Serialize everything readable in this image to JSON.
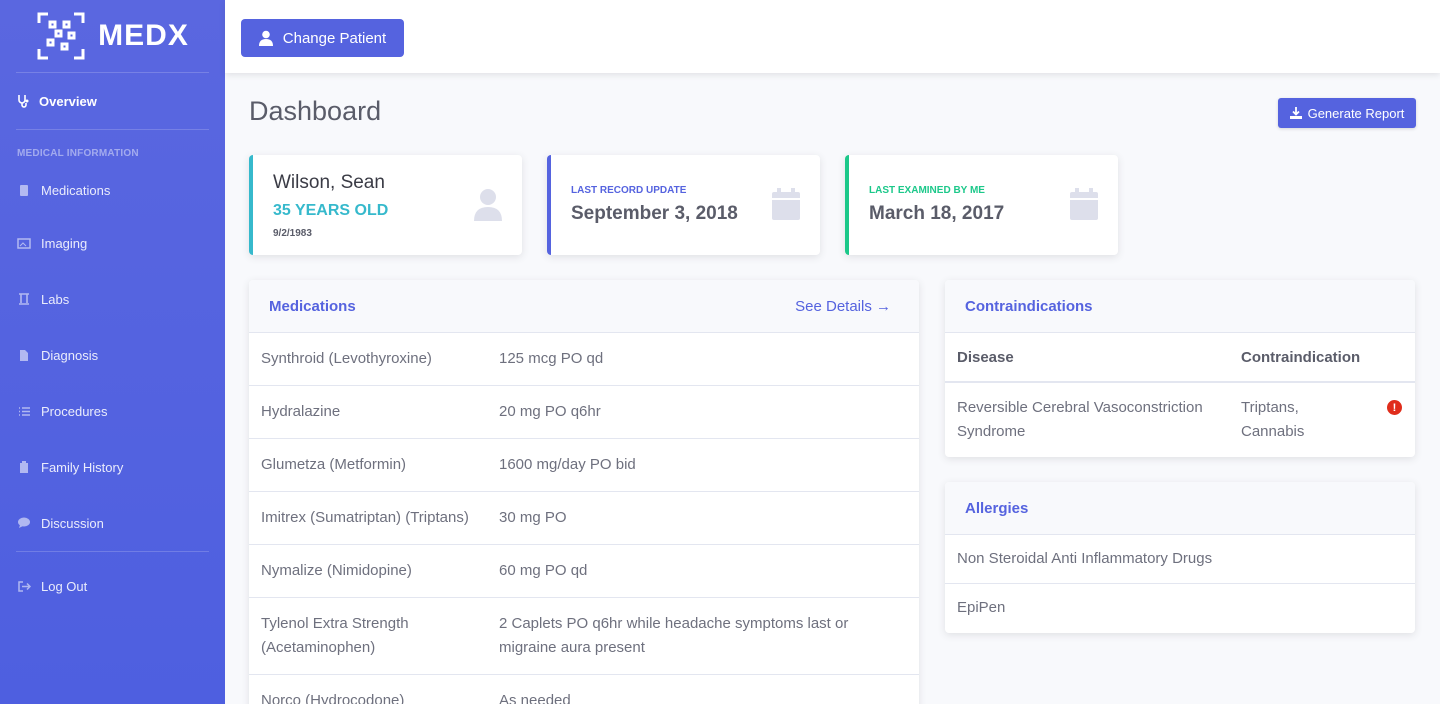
{
  "brand": {
    "name": "MEDX"
  },
  "sidebar": {
    "overview": "Overview",
    "heading": "Medical Information",
    "items": [
      {
        "label": "Medications",
        "icon": "pill-icon"
      },
      {
        "label": "Imaging",
        "icon": "image-icon"
      },
      {
        "label": "Labs",
        "icon": "flask-icon"
      },
      {
        "label": "Diagnosis",
        "icon": "file-icon"
      },
      {
        "label": "Procedures",
        "icon": "list-icon"
      },
      {
        "label": "Family History",
        "icon": "clipboard-icon"
      },
      {
        "label": "Discussion",
        "icon": "chat-icon"
      }
    ],
    "logout": "Log Out"
  },
  "topbar": {
    "change_patient": "Change Patient"
  },
  "page": {
    "title": "Dashboard",
    "report_button": "Generate Report"
  },
  "patient": {
    "name": "Wilson, Sean",
    "age": "35 YEARS OLD",
    "dob": "9/2/1983"
  },
  "last_update": {
    "label": "Last Record Update",
    "value": "September 3, 2018"
  },
  "last_exam": {
    "label": "Last Examined By Me",
    "value": "March 18, 2017"
  },
  "medications": {
    "title": "Medications",
    "see_details": "See Details →",
    "rows": [
      {
        "name": "Synthroid (Levothyroxine)",
        "dose": "125 mcg PO qd"
      },
      {
        "name": "Hydralazine",
        "dose": "20 mg PO q6hr"
      },
      {
        "name": "Glumetza (Metformin)",
        "dose": "1600 mg/day PO bid"
      },
      {
        "name": "Imitrex (Sumatriptan) (Triptans)",
        "dose": "30 mg PO"
      },
      {
        "name": "Nymalize (Nimidopine)",
        "dose": "60 mg PO qd"
      },
      {
        "name": "Tylenol Extra Strength (Acetaminophen)",
        "dose": "2 Caplets PO q6hr while headache symptoms last or migraine aura present"
      },
      {
        "name": "Norco (Hydrocodone)",
        "dose": "As needed"
      }
    ]
  },
  "contraindications": {
    "title": "Contraindications",
    "col_disease": "Disease",
    "col_contra": "Contraindication",
    "rows": [
      {
        "disease": "Reversible Cerebral Vasoconstriction Syndrome",
        "contra": "Triptans, Cannabis"
      }
    ]
  },
  "allergies": {
    "title": "Allergies",
    "items": [
      "Non Steroidal Anti Inflammatory Drugs",
      "EpiPen"
    ]
  },
  "colors": {
    "accent": "#5563df",
    "info": "#36b9cc",
    "success": "#1cc88a",
    "danger": "#e02d1b"
  }
}
